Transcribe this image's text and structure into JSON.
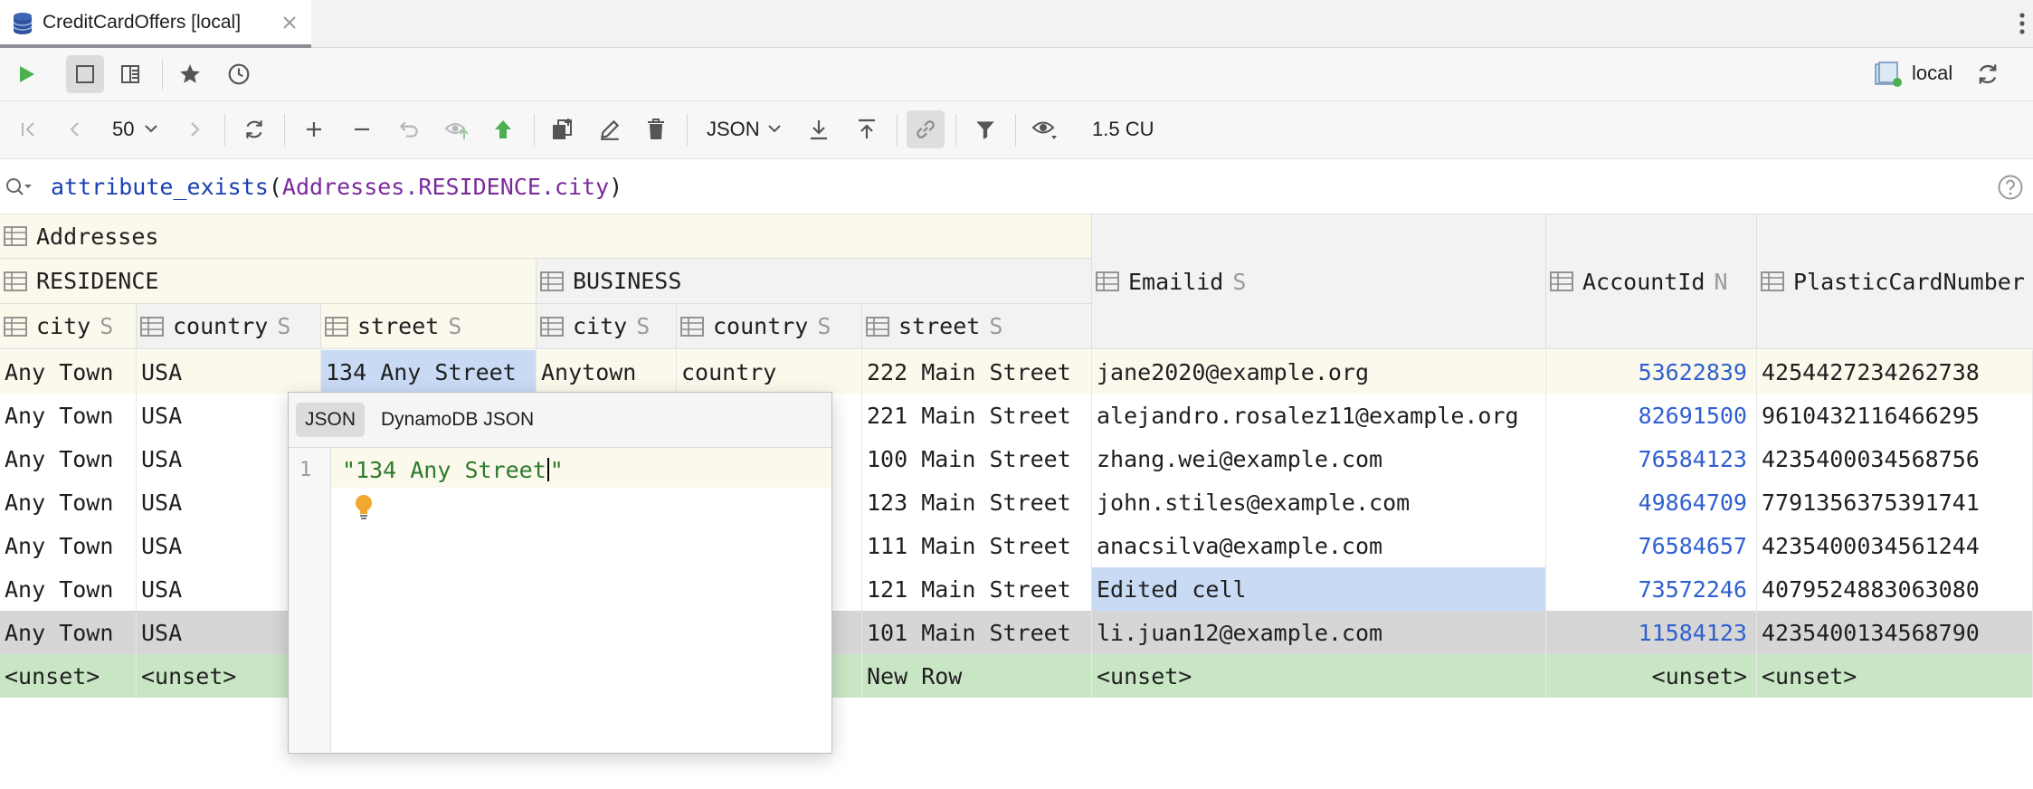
{
  "tab": {
    "title": "CreditCardOffers [local]"
  },
  "toolbar_top": {
    "connection": "local"
  },
  "toolbar_data": {
    "page_size": "50",
    "format": "JSON",
    "capacity": "1.5 CU"
  },
  "filter": {
    "fn": "attribute_exists",
    "open": "(",
    "path": "Addresses.RESIDENCE.city",
    "close": ")"
  },
  "headers": {
    "addresses": "Addresses",
    "residence": "RESIDENCE",
    "business": "BUSINESS",
    "emailid": "Emailid",
    "emailid_type": "S",
    "accountid": "AccountId",
    "accountid_type": "N",
    "plastic": "PlasticCardNumber",
    "res_city": "city",
    "res_city_type": "S",
    "res_country": "country",
    "res_country_type": "S",
    "res_street": "street",
    "res_street_type": "S",
    "bus_city": "city",
    "bus_city_type": "S",
    "bus_country": "country",
    "bus_country_type": "S",
    "bus_street": "street",
    "bus_street_type": "S"
  },
  "rows": [
    [
      "Any Town",
      "USA",
      "134 Any Street",
      "Anytown",
      "country",
      "222 Main Street",
      "jane2020@example.org",
      "53622839",
      "4254427234262738"
    ],
    [
      "Any Town",
      "USA",
      "",
      "",
      "",
      "221 Main Street",
      "alejandro.rosalez11@example.org",
      "82691500",
      "9610432116466295"
    ],
    [
      "Any Town",
      "USA",
      "",
      "",
      "",
      "100 Main Street",
      "zhang.wei@example.com",
      "76584123",
      "4235400034568756"
    ],
    [
      "Any Town",
      "USA",
      "",
      "",
      "",
      "123 Main Street",
      "john.stiles@example.com",
      "49864709",
      "7791356375391741"
    ],
    [
      "Any Town",
      "USA",
      "",
      "",
      "",
      "111 Main Street",
      "anacsilva@example.com",
      "76584657",
      "4235400034561244"
    ],
    [
      "Any Town",
      "USA",
      "",
      "",
      "",
      "121 Main Street",
      "Edited cell",
      "73572246",
      "4079524883063080"
    ],
    [
      "Any Town",
      "USA",
      "",
      "",
      "",
      "101 Main Street",
      "li.juan12@example.com",
      "11584123",
      "4235400134568790"
    ],
    [
      "<unset>",
      "<unset>",
      "",
      "",
      "",
      "New Row",
      "<unset>",
      "<unset>",
      "<unset>"
    ]
  ],
  "row_states": [
    "current",
    "normal",
    "normal",
    "normal",
    "normal",
    "edited",
    "deleted",
    "new"
  ],
  "popup": {
    "tab_json": "JSON",
    "tab_dynamodb": "DynamoDB JSON",
    "line_number": "1",
    "code_before_caret": "\"134 Any Street",
    "code_after_caret": "\""
  },
  "colors": {
    "current_row": "#fbf8ec",
    "selected_cell": "#c9daf5",
    "new_row": "#c8e6c4",
    "deleted_row": "#d6d6d6",
    "number": "#2f5fd0",
    "run_icon": "#4caf50"
  }
}
